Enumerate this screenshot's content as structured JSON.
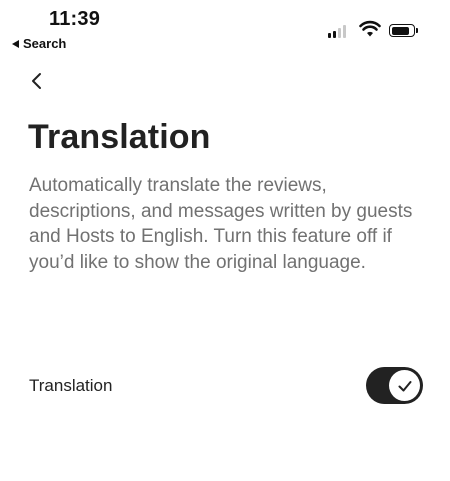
{
  "status_bar": {
    "time": "11:39",
    "back_app_label": "Search"
  },
  "header": {
    "title": "Translation",
    "description": "Automatically translate the reviews, descriptions, and messages written by guests and Hosts to English. Turn this feature off if you’d like to show the original language."
  },
  "settings": {
    "translation": {
      "label": "Translation",
      "enabled": true
    }
  },
  "icons": {
    "back": "chevron-left-icon",
    "toggle_check": "check-icon",
    "signal": "cellular-signal-icon",
    "wifi": "wifi-icon",
    "battery": "battery-icon"
  },
  "colors": {
    "toggle_on": "#222222",
    "title_text": "#222222",
    "secondary_text": "#717171"
  }
}
